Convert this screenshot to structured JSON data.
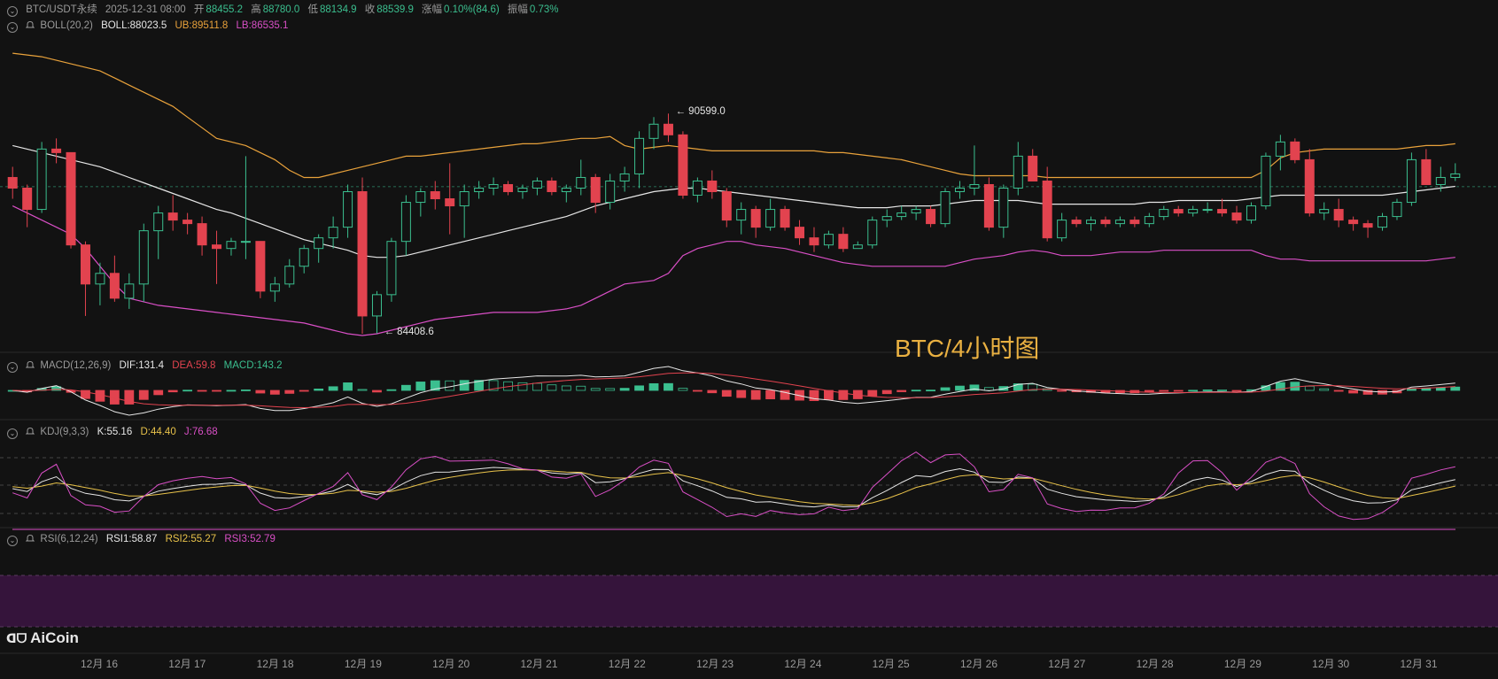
{
  "header": {
    "symbol": "BTC/USDT永续",
    "datetime": "2025-12-31 08:00",
    "open_label": "开",
    "open": "88455.2",
    "high_label": "高",
    "high": "88780.0",
    "low_label": "低",
    "low": "88134.9",
    "close_label": "收",
    "close": "88539.9",
    "change_label": "涨幅",
    "change": "0.10%(84.6)",
    "amp_label": "振幅",
    "amp": "0.73%"
  },
  "boll": {
    "name": "BOLL(20,2)",
    "mid": "BOLL:88023.5",
    "ub": "UB:89511.8",
    "lb": "LB:86535.1"
  },
  "macd": {
    "name": "MACD(12,26,9)",
    "dif": "DIF:131.4",
    "dea": "DEA:59.8",
    "macd": "MACD:143.2"
  },
  "kdj": {
    "name": "KDJ(9,3,3)",
    "k": "K:55.16",
    "d": "D:44.40",
    "j": "J:76.68"
  },
  "rsi": {
    "name": "RSI(6,12,24)",
    "r1": "RSI1:58.87",
    "r2": "RSI2:55.27",
    "r3": "RSI3:52.79"
  },
  "annotations": {
    "high_mark": "90599.0",
    "low_mark": "84408.6"
  },
  "watermark": "BTC/4小时图",
  "logo": "AiCoin",
  "dates": [
    "12月 16",
    "12月 17",
    "12月 18",
    "12月 19",
    "12月 20",
    "12月 21",
    "12月 22",
    "12月 23",
    "12月 24",
    "12月 25",
    "12月 26",
    "12月 27",
    "12月 28",
    "12月 29",
    "12月 30",
    "12月 31"
  ],
  "colors": {
    "up": "#3bbf8f",
    "down": "#e2434f",
    "mid": "#e6e6e6",
    "ub": "#e9a23b",
    "lb": "#d94fc6",
    "k": "#e6e6e6",
    "d": "#e8c24a",
    "j": "#d94fc6",
    "rsi_band": "#3a1540"
  },
  "chart_data": {
    "type": "candlestick",
    "candles": [
      [
        88800,
        89100,
        88200,
        88500
      ],
      [
        88500,
        88600,
        87400,
        87900
      ],
      [
        87900,
        89800,
        87800,
        89600
      ],
      [
        89600,
        89900,
        89200,
        89500
      ],
      [
        89500,
        89500,
        86800,
        86900
      ],
      [
        86900,
        87000,
        84900,
        85800
      ],
      [
        85800,
        86400,
        85200,
        86100
      ],
      [
        86100,
        86600,
        85300,
        85400
      ],
      [
        85400,
        86100,
        85100,
        85800
      ],
      [
        85800,
        87500,
        85300,
        87300
      ],
      [
        87300,
        88000,
        86500,
        87800
      ],
      [
        87800,
        88300,
        87300,
        87600
      ],
      [
        87600,
        87800,
        87200,
        87500
      ],
      [
        87500,
        87700,
        86600,
        86900
      ],
      [
        86900,
        87300,
        85800,
        86800
      ],
      [
        86800,
        87100,
        86600,
        87000
      ],
      [
        87000,
        89400,
        86500,
        87000
      ],
      [
        87000,
        87000,
        85400,
        85600
      ],
      [
        85600,
        86000,
        85300,
        85800
      ],
      [
        85800,
        86500,
        85700,
        86300
      ],
      [
        86300,
        86900,
        86100,
        86800
      ],
      [
        86800,
        87200,
        86400,
        87100
      ],
      [
        87100,
        87700,
        86800,
        87400
      ],
      [
        87400,
        88600,
        87100,
        88400
      ],
      [
        88400,
        88800,
        84400,
        84900
      ],
      [
        84900,
        85600,
        84408,
        85500
      ],
      [
        85500,
        87100,
        85300,
        87000
      ],
      [
        87000,
        88300,
        86600,
        88100
      ],
      [
        88100,
        88500,
        87700,
        88400
      ],
      [
        88400,
        88700,
        87900,
        88200
      ],
      [
        88200,
        89200,
        87200,
        88000
      ],
      [
        88000,
        88600,
        87100,
        88400
      ],
      [
        88400,
        88700,
        88200,
        88500
      ],
      [
        88500,
        88800,
        88300,
        88600
      ],
      [
        88600,
        88700,
        88300,
        88400
      ],
      [
        88400,
        88600,
        88200,
        88500
      ],
      [
        88500,
        88800,
        88300,
        88700
      ],
      [
        88700,
        88800,
        88300,
        88400
      ],
      [
        88400,
        88600,
        88100,
        88500
      ],
      [
        88500,
        89300,
        88300,
        88800
      ],
      [
        88800,
        88900,
        87800,
        88100
      ],
      [
        88100,
        88900,
        87900,
        88700
      ],
      [
        88700,
        89100,
        88400,
        88900
      ],
      [
        88900,
        90100,
        88500,
        89900
      ],
      [
        89900,
        90500,
        89600,
        90300
      ],
      [
        90300,
        90599,
        89800,
        90000
      ],
      [
        90000,
        90100,
        88200,
        88300
      ],
      [
        88300,
        88800,
        88100,
        88700
      ],
      [
        88700,
        89000,
        88200,
        88400
      ],
      [
        88400,
        88500,
        87400,
        87600
      ],
      [
        87600,
        88100,
        87200,
        87900
      ],
      [
        87900,
        88000,
        87100,
        87400
      ],
      [
        87400,
        88200,
        87300,
        87900
      ],
      [
        87900,
        88000,
        87300,
        87400
      ],
      [
        87400,
        87600,
        86900,
        87100
      ],
      [
        87100,
        87400,
        86700,
        86900
      ],
      [
        86900,
        87300,
        86800,
        87200
      ],
      [
        87200,
        87400,
        86700,
        86800
      ],
      [
        86800,
        87000,
        86800,
        86900
      ],
      [
        86900,
        87700,
        86800,
        87600
      ],
      [
        87600,
        87900,
        87400,
        87700
      ],
      [
        87700,
        88000,
        87600,
        87800
      ],
      [
        87800,
        88000,
        87600,
        87900
      ],
      [
        87900,
        88000,
        87400,
        87500
      ],
      [
        87500,
        88500,
        87400,
        88400
      ],
      [
        88400,
        88700,
        88200,
        88500
      ],
      [
        88500,
        89700,
        88300,
        88600
      ],
      [
        88600,
        88800,
        87300,
        87400
      ],
      [
        87400,
        88600,
        87100,
        88500
      ],
      [
        88500,
        89800,
        88300,
        89400
      ],
      [
        89400,
        89600,
        88700,
        88700
      ],
      [
        88700,
        89100,
        87000,
        87100
      ],
      [
        87100,
        87800,
        87000,
        87600
      ],
      [
        87600,
        87700,
        87400,
        87500
      ],
      [
        87500,
        87700,
        87300,
        87600
      ],
      [
        87600,
        87700,
        87400,
        87500
      ],
      [
        87500,
        87700,
        87400,
        87600
      ],
      [
        87600,
        87700,
        87400,
        87500
      ],
      [
        87500,
        87800,
        87400,
        87700
      ],
      [
        87700,
        88000,
        87600,
        87900
      ],
      [
        87900,
        88000,
        87700,
        87800
      ],
      [
        87800,
        88000,
        87700,
        87900
      ],
      [
        87900,
        88100,
        87800,
        87900
      ],
      [
        87900,
        88200,
        87700,
        87800
      ],
      [
        87800,
        88000,
        87500,
        87600
      ],
      [
        87600,
        88100,
        87500,
        88000
      ],
      [
        88000,
        89500,
        87900,
        89400
      ],
      [
        89400,
        90000,
        89000,
        89800
      ],
      [
        89800,
        89900,
        89200,
        89300
      ],
      [
        89300,
        89600,
        87700,
        87800
      ],
      [
        87800,
        88100,
        87600,
        87900
      ],
      [
        87900,
        88200,
        87400,
        87600
      ],
      [
        87600,
        87700,
        87300,
        87500
      ],
      [
        87500,
        87600,
        87100,
        87400
      ],
      [
        87400,
        87800,
        87300,
        87700
      ],
      [
        87700,
        88200,
        87600,
        88100
      ],
      [
        88100,
        89500,
        88000,
        89300
      ],
      [
        89300,
        89600,
        88600,
        88600
      ],
      [
        88600,
        89100,
        88400,
        88800
      ],
      [
        88800,
        89200,
        88700,
        88900
      ]
    ],
    "boll_mid": [
      89700,
      89600,
      89500,
      89400,
      89300,
      89200,
      89100,
      88950,
      88800,
      88650,
      88500,
      88350,
      88200,
      88050,
      87900,
      87800,
      87650,
      87500,
      87350,
      87200,
      87050,
      86950,
      86850,
      86750,
      86600,
      86550,
      86550,
      86600,
      86700,
      86800,
      86900,
      87000,
      87100,
      87200,
      87300,
      87400,
      87500,
      87600,
      87700,
      87850,
      88000,
      88100,
      88200,
      88300,
      88400,
      88450,
      88500,
      88500,
      88450,
      88400,
      88350,
      88300,
      88250,
      88200,
      88150,
      88100,
      88050,
      88000,
      87950,
      87950,
      87950,
      88000,
      88000,
      88000,
      88050,
      88100,
      88150,
      88150,
      88150,
      88150,
      88100,
      88050,
      88050,
      88050,
      88050,
      88050,
      88050,
      88050,
      88100,
      88100,
      88150,
      88150,
      88150,
      88150,
      88150,
      88200,
      88250,
      88300,
      88300,
      88300,
      88300,
      88300,
      88300,
      88300,
      88300,
      88350,
      88400,
      88450,
      88500,
      88550
    ],
    "boll_ub": [
      92300,
      92250,
      92200,
      92100,
      92000,
      91900,
      91800,
      91600,
      91400,
      91200,
      91000,
      90800,
      90500,
      90200,
      89900,
      89800,
      89700,
      89500,
      89300,
      89000,
      88800,
      88800,
      88900,
      89000,
      89100,
      89200,
      89300,
      89400,
      89400,
      89450,
      89500,
      89550,
      89600,
      89650,
      89700,
      89750,
      89750,
      89800,
      89850,
      89900,
      89900,
      89950,
      89700,
      89600,
      89650,
      89700,
      89650,
      89600,
      89550,
      89550,
      89550,
      89550,
      89550,
      89550,
      89550,
      89550,
      89500,
      89500,
      89450,
      89400,
      89350,
      89300,
      89200,
      89100,
      89000,
      88900,
      88850,
      88850,
      88850,
      88850,
      88850,
      88800,
      88800,
      88800,
      88800,
      88800,
      88800,
      88800,
      88800,
      88800,
      88800,
      88800,
      88800,
      88800,
      88800,
      88800,
      89000,
      89350,
      89500,
      89550,
      89600,
      89600,
      89600,
      89600,
      89600,
      89600,
      89650,
      89700,
      89700,
      89750
    ],
    "boll_lb": [
      88000,
      87800,
      87600,
      87400,
      87200,
      86800,
      86300,
      85800,
      85400,
      85300,
      85200,
      85150,
      85100,
      85050,
      85000,
      84950,
      84900,
      84850,
      84800,
      84750,
      84700,
      84600,
      84500,
      84400,
      84350,
      84400,
      84500,
      84600,
      84700,
      84800,
      84850,
      84900,
      84950,
      85000,
      85000,
      85000,
      85000,
      85050,
      85100,
      85200,
      85400,
      85600,
      85800,
      85850,
      85900,
      86100,
      86600,
      86800,
      86900,
      87000,
      87000,
      86900,
      86850,
      86800,
      86700,
      86600,
      86500,
      86400,
      86350,
      86300,
      86300,
      86300,
      86300,
      86300,
      86300,
      86400,
      86500,
      86550,
      86600,
      86700,
      86750,
      86700,
      86600,
      86600,
      86600,
      86650,
      86700,
      86700,
      86700,
      86750,
      86750,
      86750,
      86750,
      86750,
      86750,
      86750,
      86600,
      86500,
      86500,
      86450,
      86450,
      86450,
      86450,
      86450,
      86450,
      86450,
      86450,
      86450,
      86500,
      86550
    ],
    "price_range": [
      84200,
      92800
    ],
    "annotations": [
      {
        "index": 45,
        "label": "90599.0"
      },
      {
        "index": 25,
        "label": "84408.6"
      }
    ]
  }
}
